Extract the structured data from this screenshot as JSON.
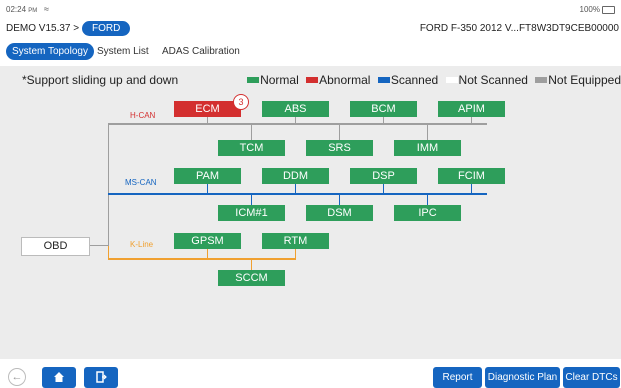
{
  "status": {
    "time": "02:24",
    "ampm": "PM",
    "battery": "100%"
  },
  "header": {
    "version": "DEMO V15.37 >",
    "brand": "FORD",
    "vehicle": "FORD  F-350  2012  V...FT8W3DT9CEB00000"
  },
  "tabs": [
    {
      "label": "System Topology"
    },
    {
      "label": "System List"
    },
    {
      "label": "ADAS Calibration"
    }
  ],
  "note": "*Support sliding up and down",
  "legend": [
    {
      "label": "Normal",
      "color": "#2e9e5b"
    },
    {
      "label": "Abnormal",
      "color": "#d32f2f"
    },
    {
      "label": "Scanned",
      "color": "#1565c0"
    },
    {
      "label": "Not Scanned",
      "color": "#ffffff"
    },
    {
      "label": "Not Equipped",
      "color": "#9e9e9e"
    }
  ],
  "buses": {
    "hcan": "H-CAN",
    "mscan": "MS-CAN",
    "kline": "K-Line"
  },
  "obd": "OBD",
  "modules": {
    "ecm": "ECM",
    "ecm_count": "3",
    "abs": "ABS",
    "bcm": "BCM",
    "apim": "APIM",
    "tcm": "TCM",
    "srs": "SRS",
    "imm": "IMM",
    "pam": "PAM",
    "ddm": "DDM",
    "dsp": "DSP",
    "fcim": "FCIM",
    "icm1": "ICM#1",
    "dsm": "DSM",
    "ipc": "IPC",
    "gpsm": "GPSM",
    "rtm": "RTM",
    "sccm": "SCCM"
  },
  "actions": {
    "report": "Report",
    "plan": "Diagnostic Plan",
    "clear": "Clear DTCs"
  }
}
